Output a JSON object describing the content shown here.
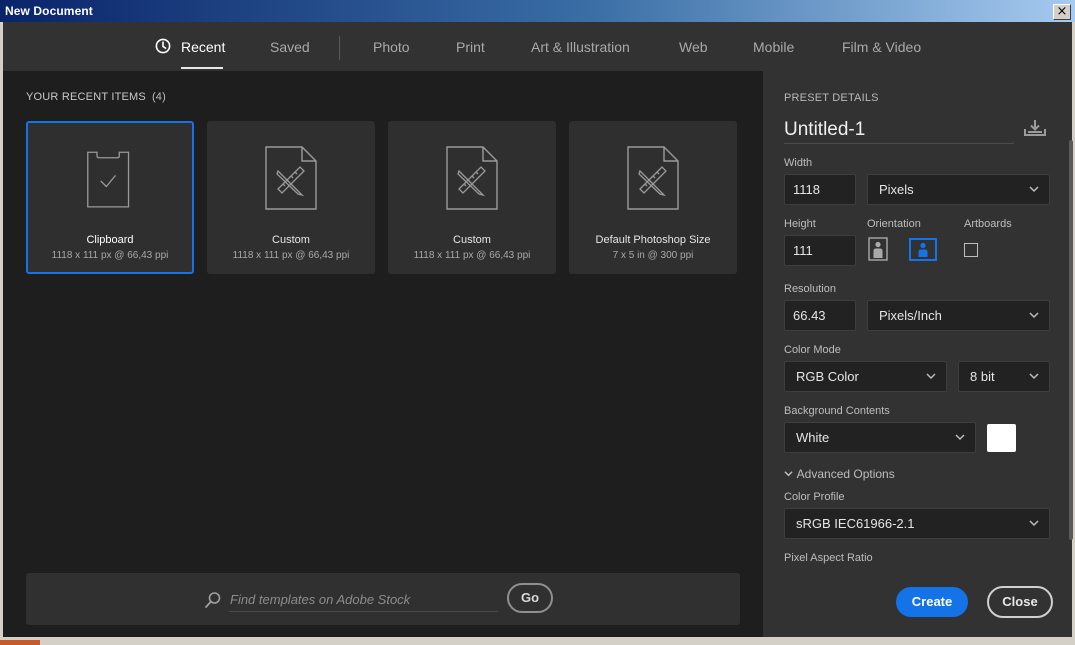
{
  "window": {
    "title": "New Document",
    "close_glyph": "×"
  },
  "tabs": [
    {
      "label": "Recent"
    },
    {
      "label": "Saved"
    },
    {
      "label": "Photo"
    },
    {
      "label": "Print"
    },
    {
      "label": "Art & Illustration"
    },
    {
      "label": "Web"
    },
    {
      "label": "Mobile"
    },
    {
      "label": "Film & Video"
    }
  ],
  "recent": {
    "title": "YOUR RECENT ITEMS",
    "count": "(4)",
    "items": [
      {
        "name": "Clipboard",
        "desc": "1118 x 111 px @ 66,43 ppi",
        "icon": "clipboard-icon"
      },
      {
        "name": "Custom",
        "desc": "1118 x 111 px @ 66,43 ppi",
        "icon": "document-ruler-pencil-icon"
      },
      {
        "name": "Custom",
        "desc": "1118 x 111 px @ 66,43 ppi",
        "icon": "document-ruler-pencil-icon"
      },
      {
        "name": "Default Photoshop Size",
        "desc": "7 x 5 in @ 300 ppi",
        "icon": "document-ruler-pencil-icon"
      }
    ]
  },
  "search": {
    "placeholder": "Find templates on Adobe Stock",
    "value": "",
    "go_label": "Go"
  },
  "preset": {
    "title": "PRESET DETAILS",
    "doc_name": "Untitled-1",
    "width_label": "Width",
    "width_value": "1118",
    "width_unit": "Pixels",
    "height_label": "Height",
    "height_value": "111",
    "orientation_label": "Orientation",
    "artboards_label": "Artboards",
    "resolution_label": "Resolution",
    "resolution_value": "66.43",
    "resolution_unit": "Pixels/Inch",
    "color_mode_label": "Color Mode",
    "color_mode": "RGB Color",
    "bit_depth": "8 bit",
    "background_label": "Background Contents",
    "background": "White",
    "background_swatch": "#ffffff",
    "advanced_label": "Advanced Options",
    "color_profile_label": "Color Profile",
    "color_profile": "sRGB IEC61966-2.1",
    "pixel_aspect_label": "Pixel Aspect Ratio"
  },
  "actions": {
    "create_label": "Create",
    "close_label": "Close"
  },
  "colors": {
    "accent": "#1473e6",
    "panel": "#323232",
    "workspace": "#1e1e1e"
  }
}
